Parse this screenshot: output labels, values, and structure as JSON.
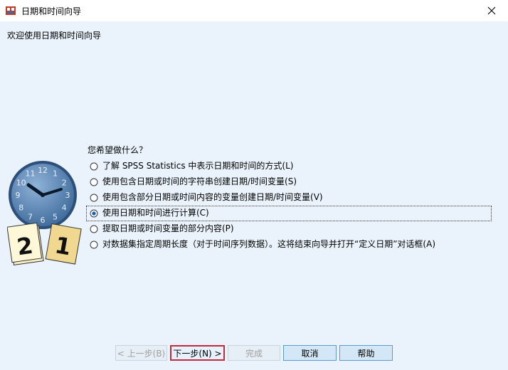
{
  "window": {
    "title": "日期和时间向导"
  },
  "welcome_text": "欢迎使用日期和时间向导",
  "question": "您希望做什么？",
  "options": [
    {
      "label": "了解 SPSS Statistics 中表示日期和时间的方式(L)",
      "selected": false
    },
    {
      "label": "使用包含日期或时间的字符串创建日期/时间变量(S)",
      "selected": false
    },
    {
      "label": "使用包含部分日期或时间内容的变量创建日期/时间变量(V)",
      "selected": false
    },
    {
      "label": "使用日期和时间进行计算(C)",
      "selected": true
    },
    {
      "label": "提取日期或时间变量的部分内容(P)",
      "selected": false
    },
    {
      "label": "对数据集指定周期长度（对于时间序列数据）。这将结束向导并打开“定义日期”对话框(A)",
      "selected": false
    }
  ],
  "clock": {
    "numbers": [
      "12",
      "1",
      "2",
      "3",
      "4",
      "5",
      "6",
      "7",
      "8",
      "9",
      "10",
      "11"
    ],
    "calendar_left": "2",
    "calendar_right": "1"
  },
  "buttons": {
    "back": "< 上一步(B)",
    "next": "下一步(N) >",
    "finish": "完成",
    "cancel": "取消",
    "help": "帮助"
  },
  "colors": {
    "background": "#eaf3fb",
    "focus_border": "#c8283c",
    "clock_face": "#5f89b5"
  }
}
